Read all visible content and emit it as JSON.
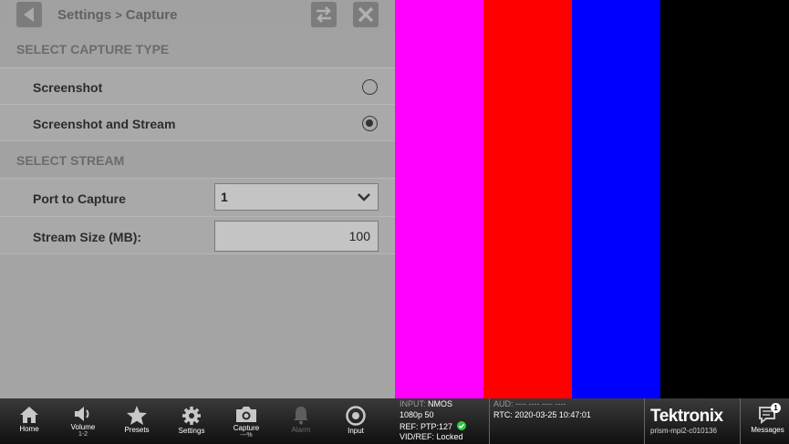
{
  "header": {
    "breadcrumb_parent": "Settings",
    "breadcrumb_sep": ">",
    "breadcrumb_current": "Capture"
  },
  "capture_type": {
    "section_title": "SELECT CAPTURE TYPE",
    "options": [
      {
        "label": "Screenshot",
        "selected": false
      },
      {
        "label": "Screenshot and Stream",
        "selected": true
      }
    ]
  },
  "stream": {
    "section_title": "SELECT STREAM",
    "port_label": "Port to Capture",
    "port_value": "1",
    "size_label": "Stream Size (MB):",
    "size_value": "100"
  },
  "color_bars": [
    "#ff00ff",
    "#ff0000",
    "#0000ff",
    "#000000"
  ],
  "dock": [
    {
      "label": "Home",
      "sub": "",
      "icon": "home-icon"
    },
    {
      "label": "Volume",
      "sub": "1-2",
      "icon": "speaker-icon"
    },
    {
      "label": "Presets",
      "sub": "",
      "icon": "star-icon"
    },
    {
      "label": "Settings",
      "sub": "",
      "icon": "gear-icon"
    },
    {
      "label": "Capture",
      "sub": "---%",
      "icon": "camera-icon"
    },
    {
      "label": "Alarm",
      "sub": "",
      "icon": "bell-icon"
    },
    {
      "label": "Input",
      "sub": "",
      "icon": "input-icon"
    }
  ],
  "status": {
    "input_key": "INPUT:",
    "input_value": "NMOS",
    "format": "1080p 50",
    "ref": "REF: PTP:127",
    "vidref": "VID/REF: Locked",
    "aud": "AUD: ---- ---- ---- ----",
    "rtc": "RTC: 2020-03-25 10:47:01"
  },
  "brand": {
    "name": "Tektronix",
    "host": "prism-mpi2-c010136"
  },
  "messages": {
    "label": "Messages",
    "count": "1"
  },
  "colors": {
    "ok_green": "#2ecc40",
    "panel_gray": "#a4a4a4"
  }
}
